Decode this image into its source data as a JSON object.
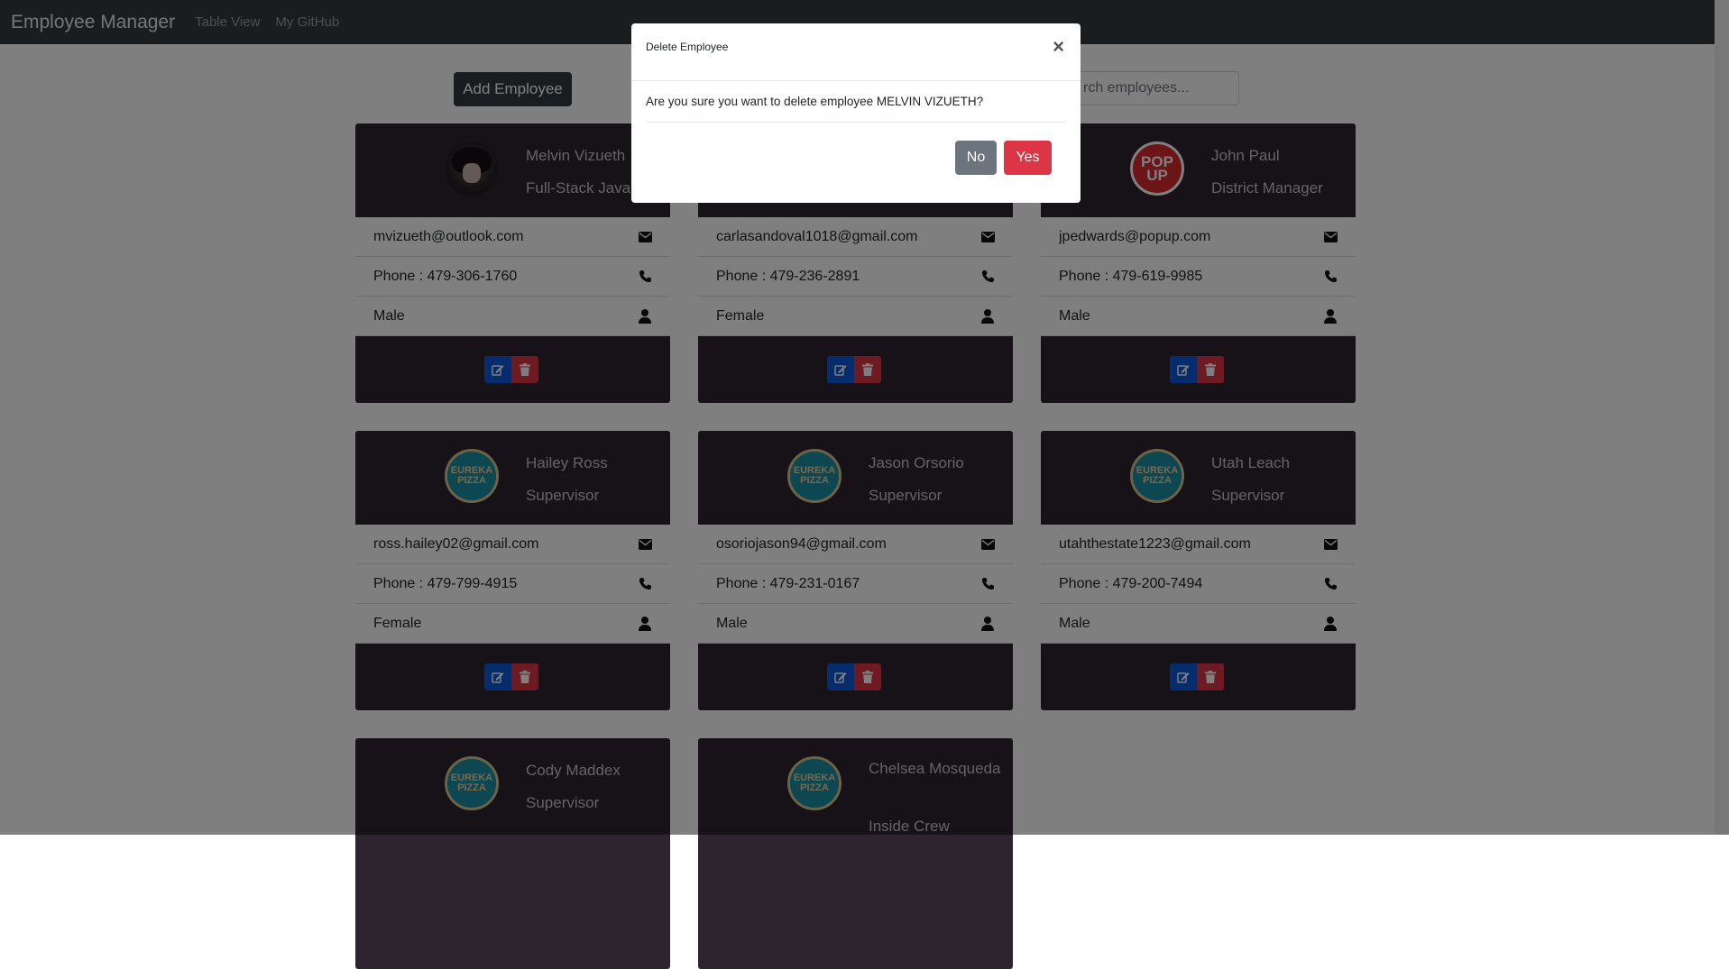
{
  "navbar": {
    "brand": "Employee Manager",
    "links": [
      "Table View",
      "My GitHub"
    ]
  },
  "toolbar": {
    "add_label": "Add Employee",
    "search_placeholder": "rch employees..."
  },
  "colors": {
    "card_bg": "#2d2430",
    "navbar_bg": "#343a40",
    "edit": "#0a58d8",
    "delete": "#dc3545"
  },
  "employees": [
    {
      "name": "Melvin Vizueth",
      "title": "Full-Stack Java",
      "email": "mvizueth@outlook.com",
      "phone": "Phone : 479-306-1760",
      "gender": "Male",
      "avatar": "anime-portrait"
    },
    {
      "name": "",
      "title": "",
      "email": "carlasandoval1018@gmail.com",
      "phone": "Phone : 479-236-2891",
      "gender": "Female",
      "avatar": ""
    },
    {
      "name": "John Paul",
      "title": "District Manager",
      "email": "jpedwards@popup.com",
      "phone": "Phone : 479-619-9985",
      "gender": "Male",
      "avatar": "popup-logo"
    },
    {
      "name": "Hailey Ross",
      "title": "Supervisor",
      "email": "ross.hailey02@gmail.com",
      "phone": "Phone : 479-799-4915",
      "gender": "Female",
      "avatar": "eureka-pizza-logo"
    },
    {
      "name": "Jason Orsorio",
      "title": "Supervisor",
      "email": "osoriojason94@gmail.com",
      "phone": "Phone : 479-231-0167",
      "gender": "Male",
      "avatar": "eureka-pizza-logo"
    },
    {
      "name": "Utah Leach",
      "title": "Supervisor",
      "email": "utahthestate1223@gmail.com",
      "phone": "Phone : 479-200-7494",
      "gender": "Male",
      "avatar": "eureka-pizza-logo"
    },
    {
      "name": "Cody Maddex",
      "title": "Supervisor",
      "avatar": "eureka-pizza-logo"
    },
    {
      "name": "Chelsea Mosqueda",
      "title": "Inside Crew",
      "avatar": "eureka-pizza-logo"
    }
  ],
  "logos": {
    "popup": "POP UP",
    "eureka": "EUREKA PIZZA"
  },
  "modal": {
    "title": "Delete Employee",
    "close": "×",
    "message": "Are you sure you want to delete employee MELVIN VIZUETH?",
    "no_label": "No",
    "yes_label": "Yes"
  }
}
